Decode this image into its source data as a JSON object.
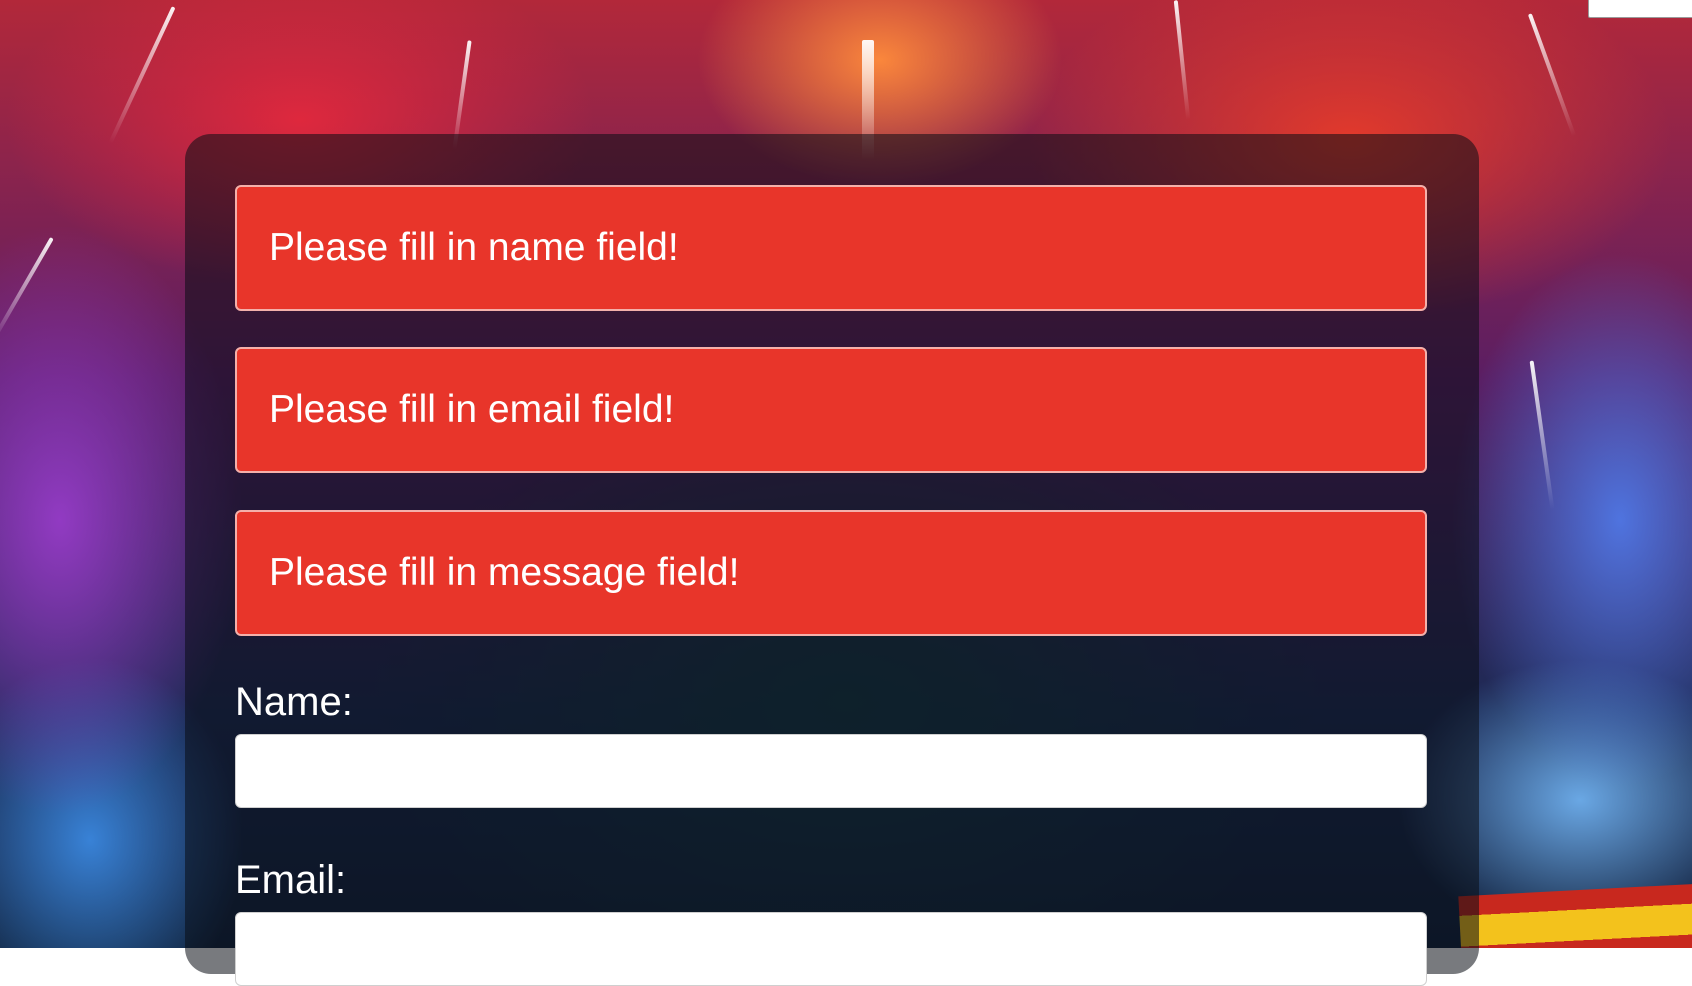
{
  "errors": {
    "name": "Please fill in name field!",
    "email": "Please fill in email field!",
    "message": "Please fill in message field!"
  },
  "form": {
    "name_label": "Name:",
    "name_value": "",
    "email_label": "Email:",
    "email_value": ""
  },
  "colors": {
    "error_background": "#e8352a",
    "panel_overlay": "#0a0c14"
  }
}
